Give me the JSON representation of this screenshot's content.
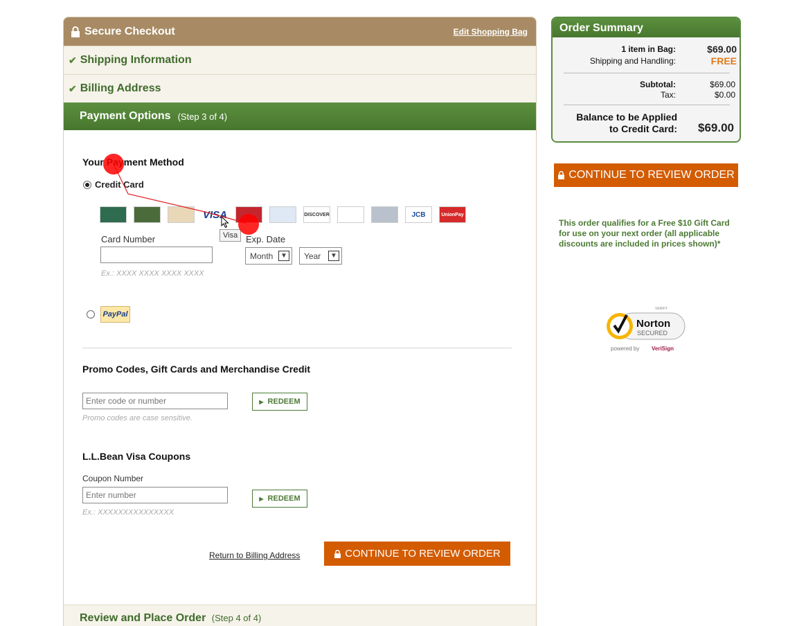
{
  "checkout": {
    "title": "Secure Checkout",
    "edit_link": "Edit Shopping Bag",
    "steps_done": [
      "Shipping Information",
      "Billing Address"
    ],
    "active_step": {
      "title": "Payment Options",
      "subtitle": "(Step 3 of 4)"
    },
    "next_step": {
      "title": "Review and Place Order",
      "subtitle": "(Step 4 of 4)"
    }
  },
  "payment": {
    "heading": "Your Payment Method",
    "credit_card_label": "Credit Card",
    "cards": [
      {
        "name": "L.L.Bean Visa",
        "icon": "llbean-visa-card-icon",
        "cls": "llb1",
        "text": ""
      },
      {
        "name": "L.L.Bean Visa",
        "icon": "llbean-visa-card-2-icon",
        "cls": "llb2",
        "text": ""
      },
      {
        "name": "L.L.Bean Card",
        "icon": "llbean-card-icon",
        "cls": "llb3",
        "text": ""
      },
      {
        "name": "Visa",
        "icon": "visa-icon",
        "cls": "visa",
        "text": "VISA"
      },
      {
        "name": "MasterCard",
        "icon": "mastercard-icon",
        "cls": "mc",
        "text": ""
      },
      {
        "name": "American Express",
        "icon": "amex-icon",
        "cls": "amex",
        "text": ""
      },
      {
        "name": "Discover",
        "icon": "discover-icon",
        "cls": "disc",
        "text": "DISCOVER"
      },
      {
        "name": "Diners Club",
        "icon": "diners-club-icon",
        "cls": "din",
        "text": ""
      },
      {
        "name": "Card",
        "icon": "generic-card-icon",
        "cls": "gray",
        "text": ""
      },
      {
        "name": "JCB",
        "icon": "jcb-icon",
        "cls": "jcb",
        "text": "JCB"
      },
      {
        "name": "UnionPay",
        "icon": "unionpay-icon",
        "cls": "union",
        "text": "UnionPay"
      }
    ],
    "tooltip": "Visa",
    "card_number_label": "Card Number",
    "card_number_hint": "Ex.: XXXX XXXX XXXX XXXX",
    "exp_label": "Exp. Date",
    "month_value": "Month",
    "year_value": "Year",
    "paypal_label": "PayPal"
  },
  "promo": {
    "heading": "Promo Codes, Gift Cards and Merchandise Credit",
    "placeholder": "Enter code or number",
    "redeem_label": "REDEEM",
    "hint": "Promo codes are case sensitive."
  },
  "coupons": {
    "heading": "L.L.Bean Visa Coupons",
    "label": "Coupon Number",
    "placeholder": "Enter number",
    "redeem_label": "REDEEM",
    "hint": "Ex.: XXXXXXXXXXXXXXX"
  },
  "actions": {
    "back_link": "Return to Billing Address",
    "continue_label": "CONTINUE TO REVIEW ORDER"
  },
  "summary": {
    "title": "Order Summary",
    "items_label": "1 item in Bag:",
    "items_value": "$69.00",
    "shipping_label": "Shipping and Handling:",
    "shipping_value": "FREE",
    "subtotal_label": "Subtotal:",
    "subtotal_value": "$69.00",
    "tax_label": "Tax:",
    "tax_value": "$0.00",
    "balance_label_1": "Balance to be Applied",
    "balance_label_2": "to Credit Card:",
    "balance_value": "$69.00"
  },
  "sidebar": {
    "continue_label": "CONTINUE TO REVIEW ORDER",
    "qualify_text": "This order qualifies for a Free $10 Gift Card for use on your next order (all applicable discounts are included in prices shown)*"
  },
  "norton": {
    "verify": "VERIFY",
    "brand": "Norton",
    "secured": "SECURED",
    "powered_by": "powered by",
    "verisign": "VeriSign"
  },
  "colors": {
    "header_tan": "#a88b64",
    "green": "#4d7e33",
    "orange": "#d35b00"
  }
}
